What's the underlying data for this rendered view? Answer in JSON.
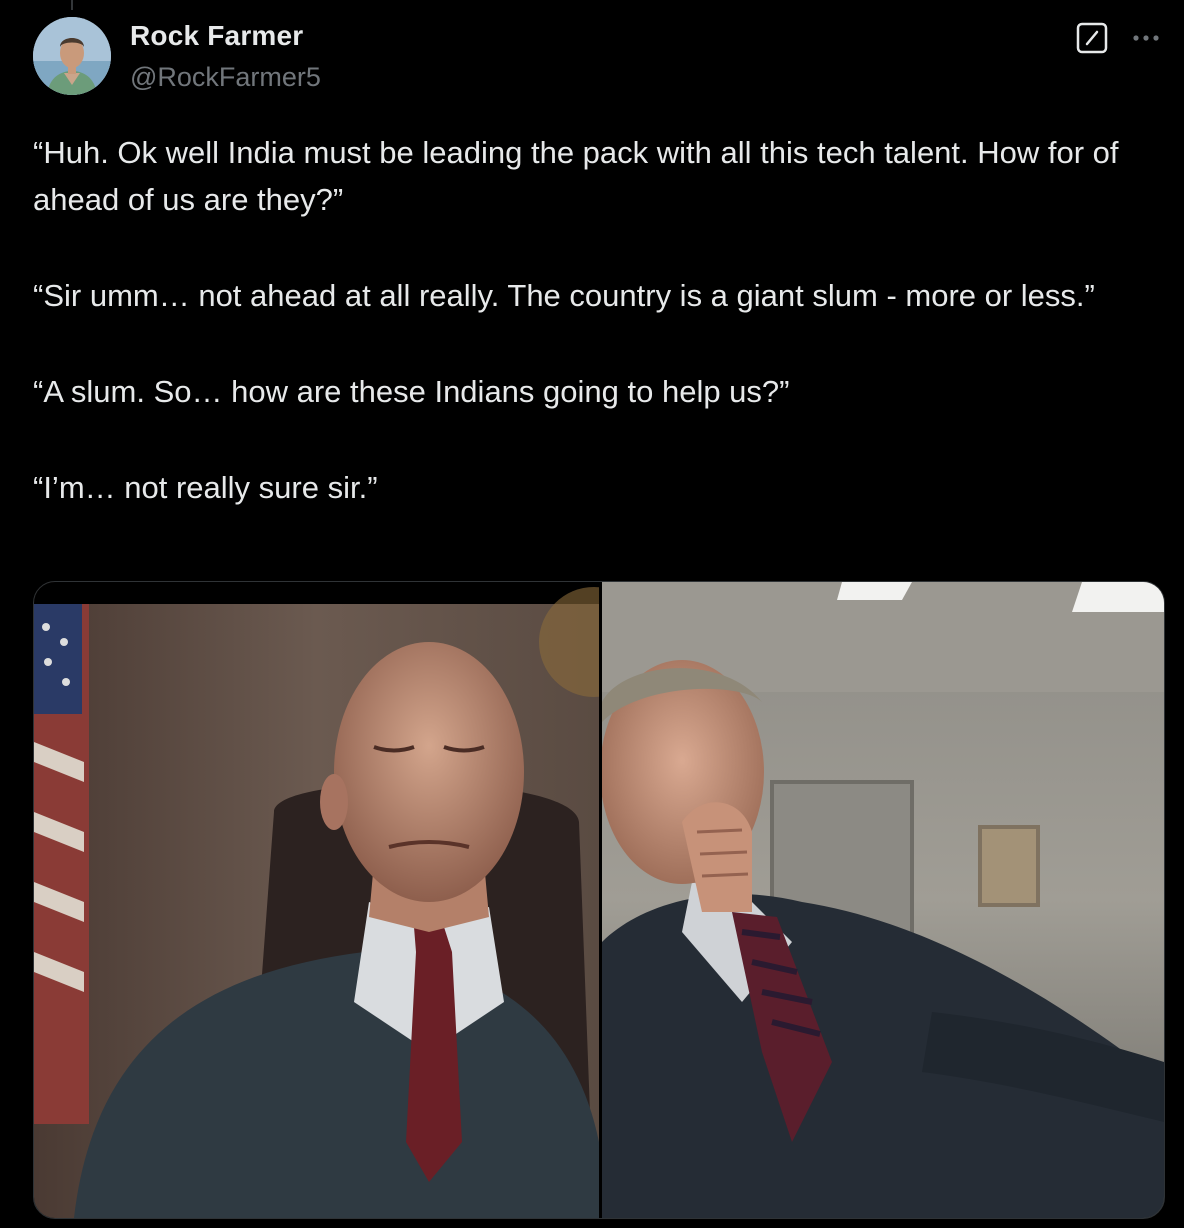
{
  "author": {
    "display_name": "Rock Farmer",
    "handle": "@RockFarmer5",
    "avatar_icon": "profile-photo-avatar"
  },
  "actions": {
    "grok_icon": "grok-slash-box-icon",
    "more_icon": "more-dots-icon"
  },
  "tweet": {
    "paragraphs": [
      "“Huh. Ok well India must be leading the pack with all this tech talent. How for of ahead of us are they?”",
      "“Sir umm… not ahead at all really. The country is a giant slum - more or less.”",
      "“A slum. So… how are these Indians going to help us?”",
      "“I’m… not really sure sir.”"
    ]
  },
  "media": {
    "count": 2,
    "images": [
      {
        "description_icon": "photo-bald-man-in-suit-office-flag"
      },
      {
        "description_icon": "photo-man-hand-on-face-office"
      }
    ]
  },
  "colors": {
    "background": "#000000",
    "text": "#e7e9ea",
    "secondary_text": "#71767b",
    "border": "#2f3336"
  }
}
